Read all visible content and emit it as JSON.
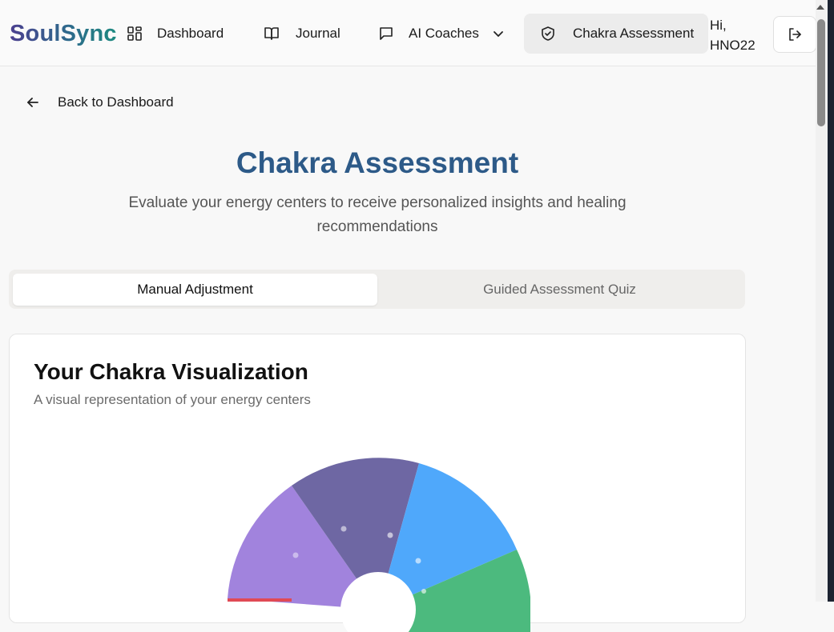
{
  "header": {
    "brand": "SoulSync",
    "nav": [
      {
        "label": "Dashboard",
        "icon": "grid-icon"
      },
      {
        "label": "Journal",
        "icon": "book-open-icon"
      },
      {
        "label": "AI Coaches",
        "icon": "message-square-icon"
      },
      {
        "label": "Chakra Assessment",
        "icon": "shield-check-icon",
        "active": true
      }
    ],
    "greeting_line1": "Hi,",
    "greeting_line2": "HNO22"
  },
  "back_link": "Back to Dashboard",
  "page_title": "Chakra Assessment",
  "page_subtitle": "Evaluate your energy centers to receive personalized insights and healing recommendations",
  "tabs": [
    "Manual Adjustment",
    "Guided Assessment Quiz"
  ],
  "visualization": {
    "title": "Your Chakra Visualization",
    "subtitle": "A visual representation of your energy centers",
    "segment_colors": [
      "#a183dd",
      "#6e67a3",
      "#4fa8fb",
      "#4cba7e",
      "#e04a55"
    ]
  },
  "colors": {
    "accent_title": "#2d5a88",
    "brand_gradient_start": "#4b3f8f",
    "brand_gradient_end": "#1d8a80"
  }
}
